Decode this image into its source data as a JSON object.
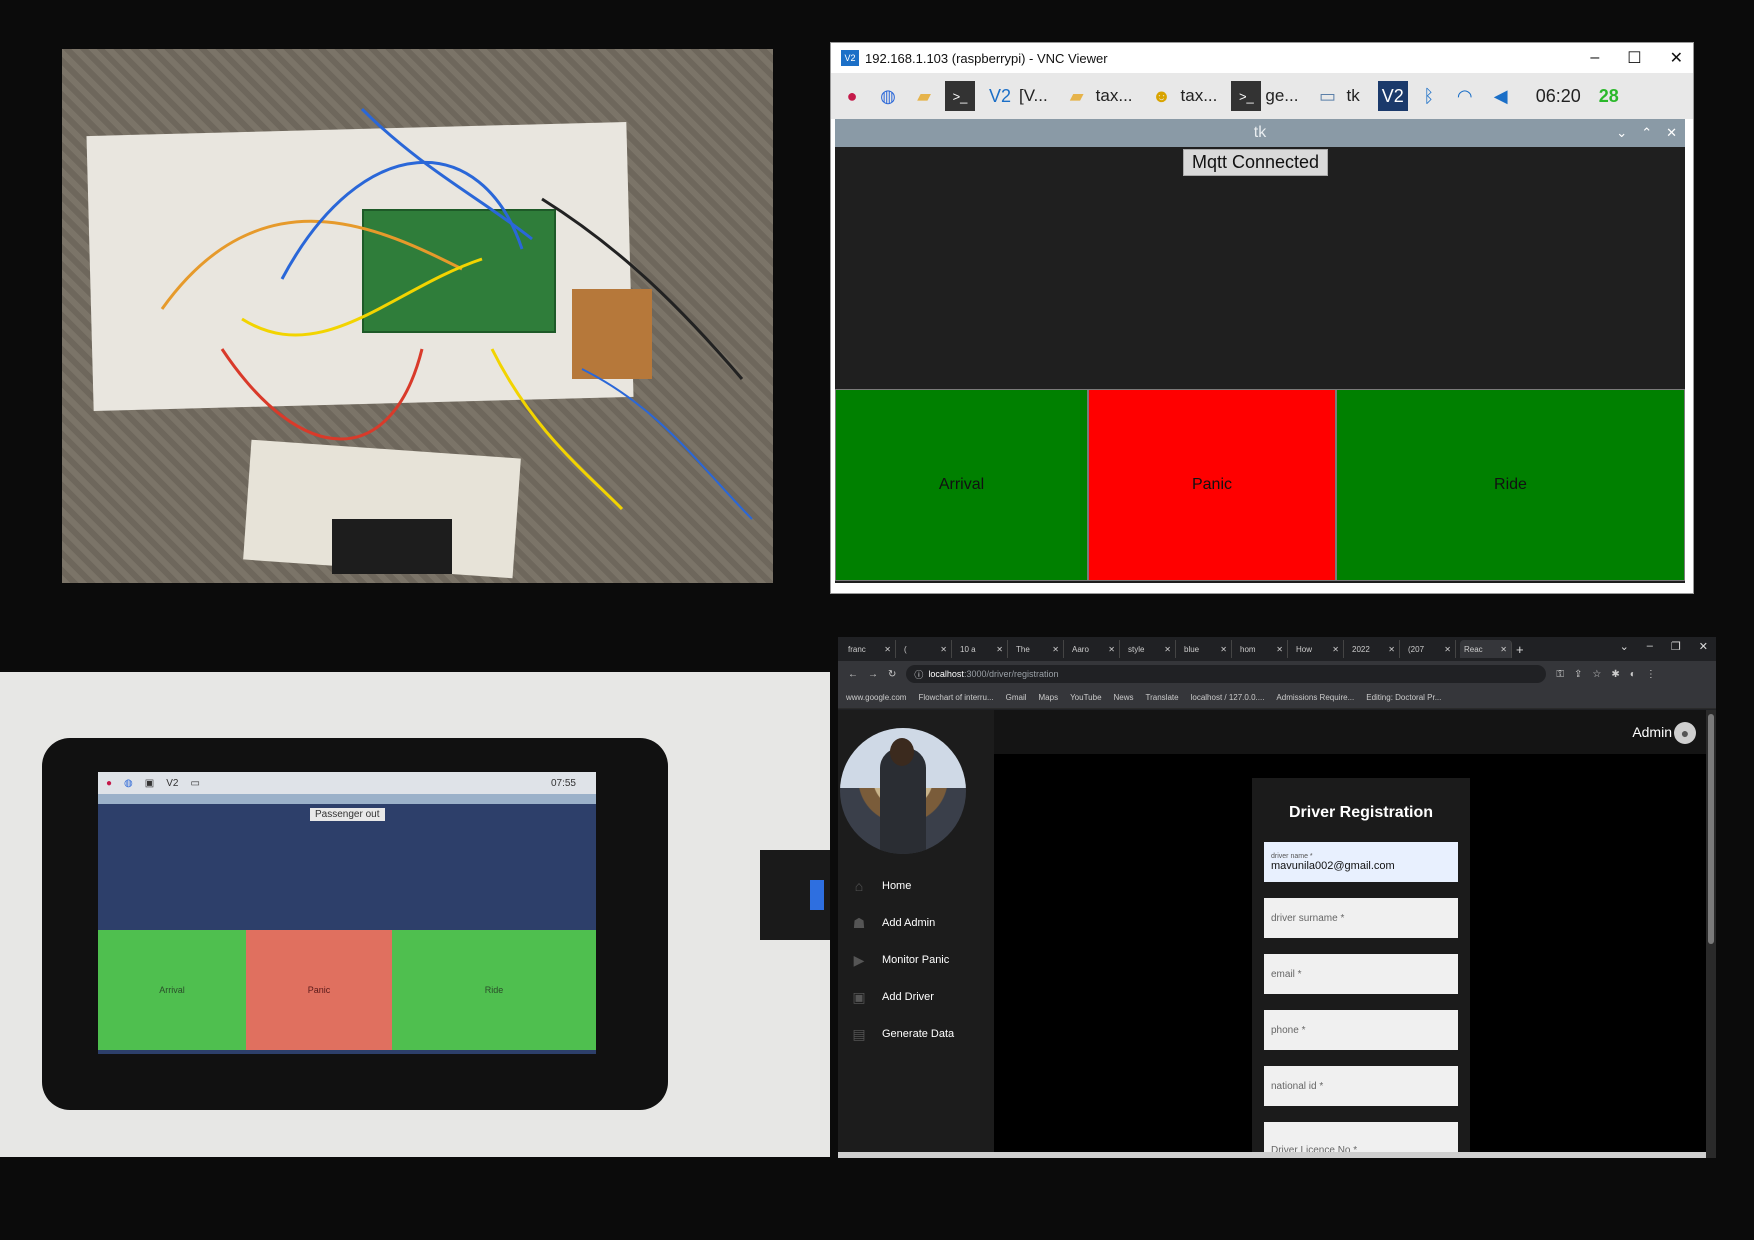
{
  "vnc": {
    "title": "192.168.1.103 (raspberrypi) - VNC Viewer",
    "controls": [
      "–",
      "☐",
      "✕"
    ],
    "taskbar": {
      "items": [
        {
          "icon": "raspberry-icon",
          "label": ""
        },
        {
          "icon": "globe-icon",
          "label": ""
        },
        {
          "icon": "folders-icon",
          "label": ""
        },
        {
          "icon": "terminal-icon",
          "label": ""
        },
        {
          "icon": "vnc-icon",
          "label": "[V..."
        },
        {
          "icon": "folder-icon",
          "label": "tax..."
        },
        {
          "icon": "python-icon",
          "label": "tax..."
        },
        {
          "icon": "terminal-icon",
          "label": "ge..."
        },
        {
          "icon": "window-icon",
          "label": "tk"
        }
      ],
      "clock": "06:20",
      "cpu": "28"
    },
    "tk": {
      "title": "tk",
      "status": "Mqtt Connected",
      "buttons": [
        "Arrival",
        "Panic",
        "Ride"
      ]
    }
  },
  "device": {
    "status": "Passenger out",
    "clock": "07:55",
    "buttons": [
      "Arrival",
      "Panic",
      "Ride"
    ]
  },
  "browser": {
    "tabs": [
      "franc",
      "(",
      "10 a",
      "The",
      "Aaro",
      "style",
      "blue",
      "hom",
      "How",
      "2022",
      "(207",
      "Reac"
    ],
    "url_host": "localhost",
    "url_path": ":3000/driver/registration",
    "bookmarks": [
      "www.google.com",
      "Flowchart of interru...",
      "Gmail",
      "Maps",
      "YouTube",
      "News",
      "Translate",
      "localhost / 127.0.0....",
      "Admissions Require...",
      "Editing: Doctoral Pr..."
    ],
    "app": {
      "admin_label": "Admin",
      "nav": [
        "Home",
        "Add Admin",
        "Monitor Panic",
        "Add Driver",
        "Generate Data"
      ],
      "form_title": "Driver Registration",
      "fields": [
        {
          "label": "driver name *",
          "value": "mavunila002@gmail.com"
        },
        {
          "placeholder": "driver surname *"
        },
        {
          "placeholder": "email *"
        },
        {
          "placeholder": "phone *"
        },
        {
          "placeholder": "national id *"
        },
        {
          "placeholder": "Driver Licence No *"
        }
      ]
    }
  },
  "colors": {
    "green": "#008000",
    "red": "#ff0000",
    "dark": "#1f1f1f"
  }
}
